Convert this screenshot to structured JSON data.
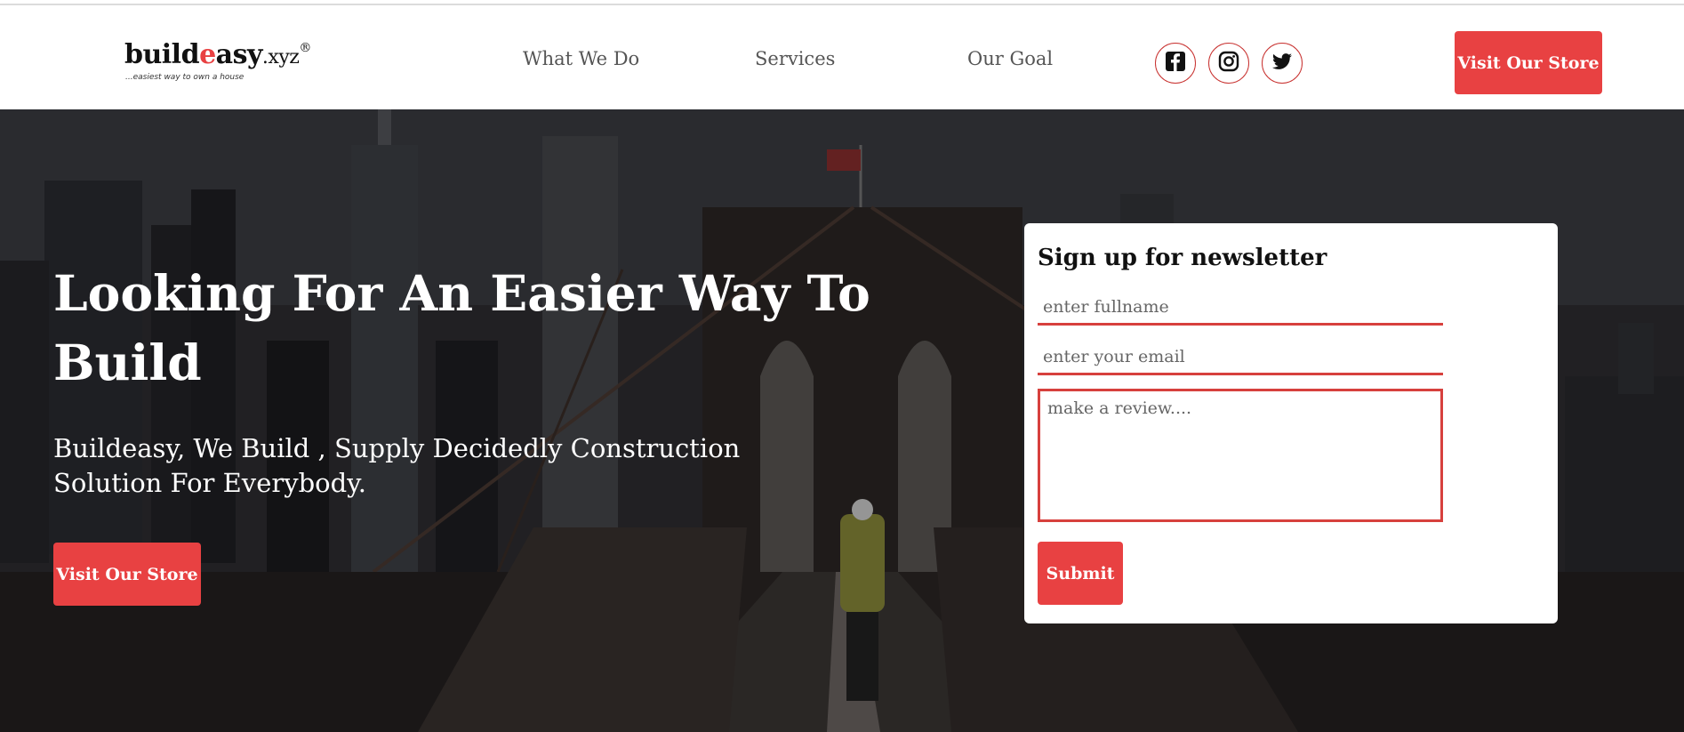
{
  "header": {
    "logo": {
      "main_text": "build",
      "accent_text": "e",
      "rest_text": "asy",
      "extension": ".xyz",
      "registered": "®",
      "tagline": "...easiest way to own a house"
    },
    "nav": [
      {
        "label": "What We Do"
      },
      {
        "label": "Services"
      },
      {
        "label": "Our Goal"
      }
    ],
    "social": [
      {
        "icon": "facebook-icon"
      },
      {
        "icon": "instagram-icon"
      },
      {
        "icon": "twitter-icon"
      }
    ],
    "store_button": "Visit Our Store"
  },
  "hero": {
    "title": "Looking For An Easier Way To Build",
    "subtitle": "Buildeasy, We Build , Supply Decidedly Construction Solution For Everybody.",
    "store_button": "Visit Our Store",
    "background": "bridge-city-photo"
  },
  "newsletter": {
    "title": "Sign up for newsletter",
    "fullname_placeholder": "enter fullname",
    "email_placeholder": "enter your email",
    "review_placeholder": "make a review....",
    "submit_label": "Submit"
  },
  "colors": {
    "accent": "#e84142",
    "nav_text": "#555555",
    "social_border": "#c8312f"
  }
}
